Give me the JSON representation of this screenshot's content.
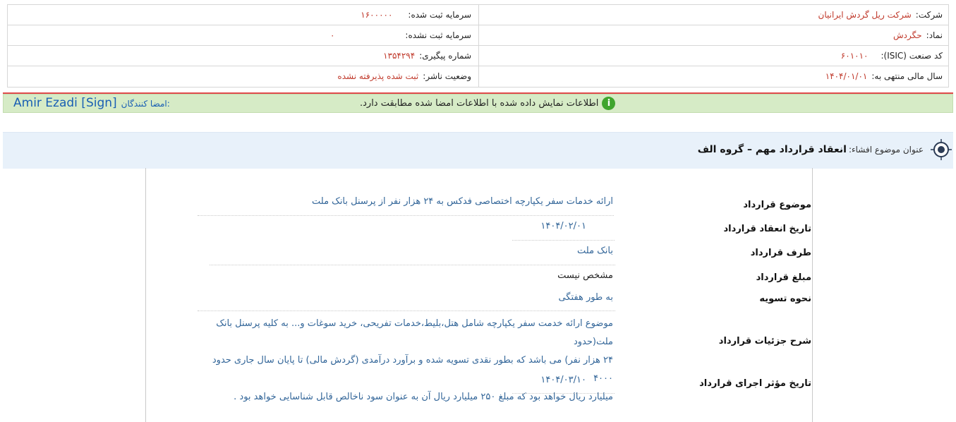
{
  "header": {
    "company_label": "شرکت:",
    "company_value": "شرکت ریل گردش ایرانیان",
    "symbol_label": "نماد:",
    "symbol_value": "حگردش",
    "isic_label": "کد صنعت (ISIC):",
    "isic_value": "۶۰۱۰۱۰",
    "fiscal_label": "سال مالی منتهی به:",
    "fiscal_value": "۱۴۰۴/۰۱/۰۱",
    "registered_capital_label": "سرمایه ثبت شده:",
    "registered_capital_value": "۱۶۰۰۰۰۰",
    "unregistered_capital_label": "سرمایه ثبت نشده:",
    "unregistered_capital_value": "۰",
    "tracking_label": "شماره پیگیری:",
    "tracking_value": "۱۳۵۴۲۹۴",
    "publisher_status_label": "وضعیت ناشر:",
    "publisher_status_value": "ثبت شده پذیرفته نشده"
  },
  "signature": {
    "signers_label": "امضا کنندگان:",
    "signer_name": "Amir Ezadi [Sign]",
    "verified_message": "اطلاعات نمایش داده شده با اطلاعات امضا شده مطابقت دارد.",
    "icon": "info-icon",
    "colors": {
      "bar_bg": "#d6ebc6",
      "icon_bg": "#3fa52d",
      "top_line": "#e04b4b"
    }
  },
  "subject": {
    "label": "عنوان موضوع افشاء:",
    "title": "انعقاد قرارداد مهم – گروه الف",
    "icon": "target-icon"
  },
  "details": {
    "subject_label": "موضوع قرارداد",
    "subject_value": "ارائه خدمات سفر یکپارچه اختصاصی فدکس به ۲۴ هزار نفر از پرسنل بانک ملت",
    "date_label": "تاریخ انعقاد قرارداد",
    "date_value": "۱۴۰۴/۰۲/۰۱",
    "party_label": "طرف قرارداد",
    "party_value": "بانک ملت",
    "amount_label": "مبلغ قرارداد",
    "amount_value": "مشخص نیست",
    "settlement_label": "نحوه تسویه",
    "settlement_value": "به طور هفتگی",
    "description_label": "شرح جزئیات قرارداد",
    "description_lines": [
      "موضوع ارائه خدمت سفر یکپارچه شامل هتل،بلیط،خدمات تفریحی، خرید سوغات و... به کلیه پرسنل بانک ملت(حدود",
      "۲۴ هزار نفر) می باشد که بطور نقدی تسویه شده و برآورد درآمدی (گردش مالی) تا پایان سال جاری حدود ۴۰۰۰",
      "میلیارد ریال خواهد بود که مبلغ ۲۵۰ میلیارد ریال آن به عنوان سود ناخالص قابل شناسایی خواهد بود ."
    ],
    "effective_date_label": "تاریخ مؤثر اجرای قرارداد",
    "effective_date_value": "۱۴۰۴/۰۳/۱۰"
  }
}
